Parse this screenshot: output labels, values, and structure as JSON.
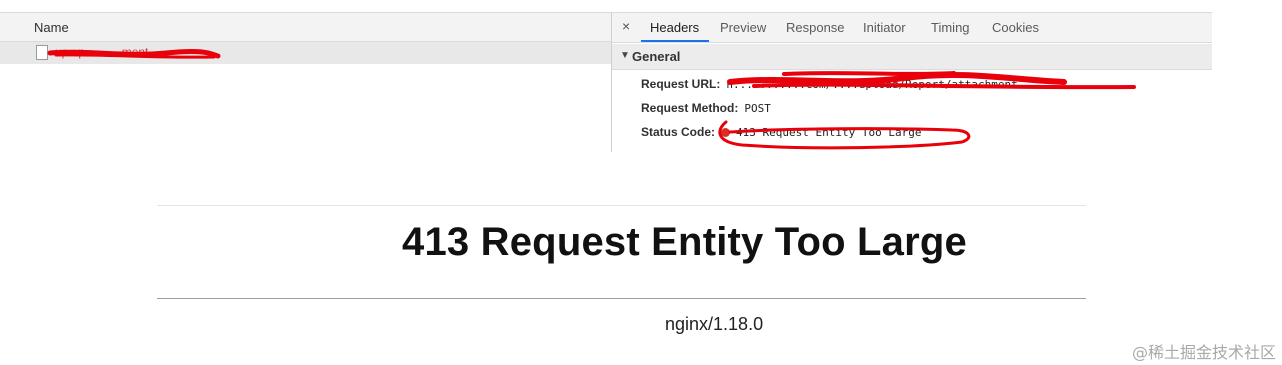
{
  "network_list": {
    "header_label": "Name",
    "request_name": "up...p...........ment"
  },
  "detail": {
    "close_label": "×",
    "tabs": [
      "Headers",
      "Preview",
      "Response",
      "Initiator",
      "Timing",
      "Cookies"
    ],
    "active_tab": "Headers",
    "section_caret": "▼",
    "section_label": "General",
    "request_url_key": "Request URL:",
    "request_url_value": "h...........com/....upload/Report/attachment",
    "request_method_key": "Request Method:",
    "request_method_value": "POST",
    "status_code_key": "Status Code:",
    "status_code_value": "413 Request Entity Too Large",
    "status_color": "#d93025"
  },
  "error_page": {
    "title": "413 Request Entity Too Large",
    "server": "nginx/1.18.0"
  },
  "watermark": "@稀土掘金技术社区",
  "colors": {
    "redaction": "#e8000b",
    "active_tab_accent": "#1a73e8"
  }
}
